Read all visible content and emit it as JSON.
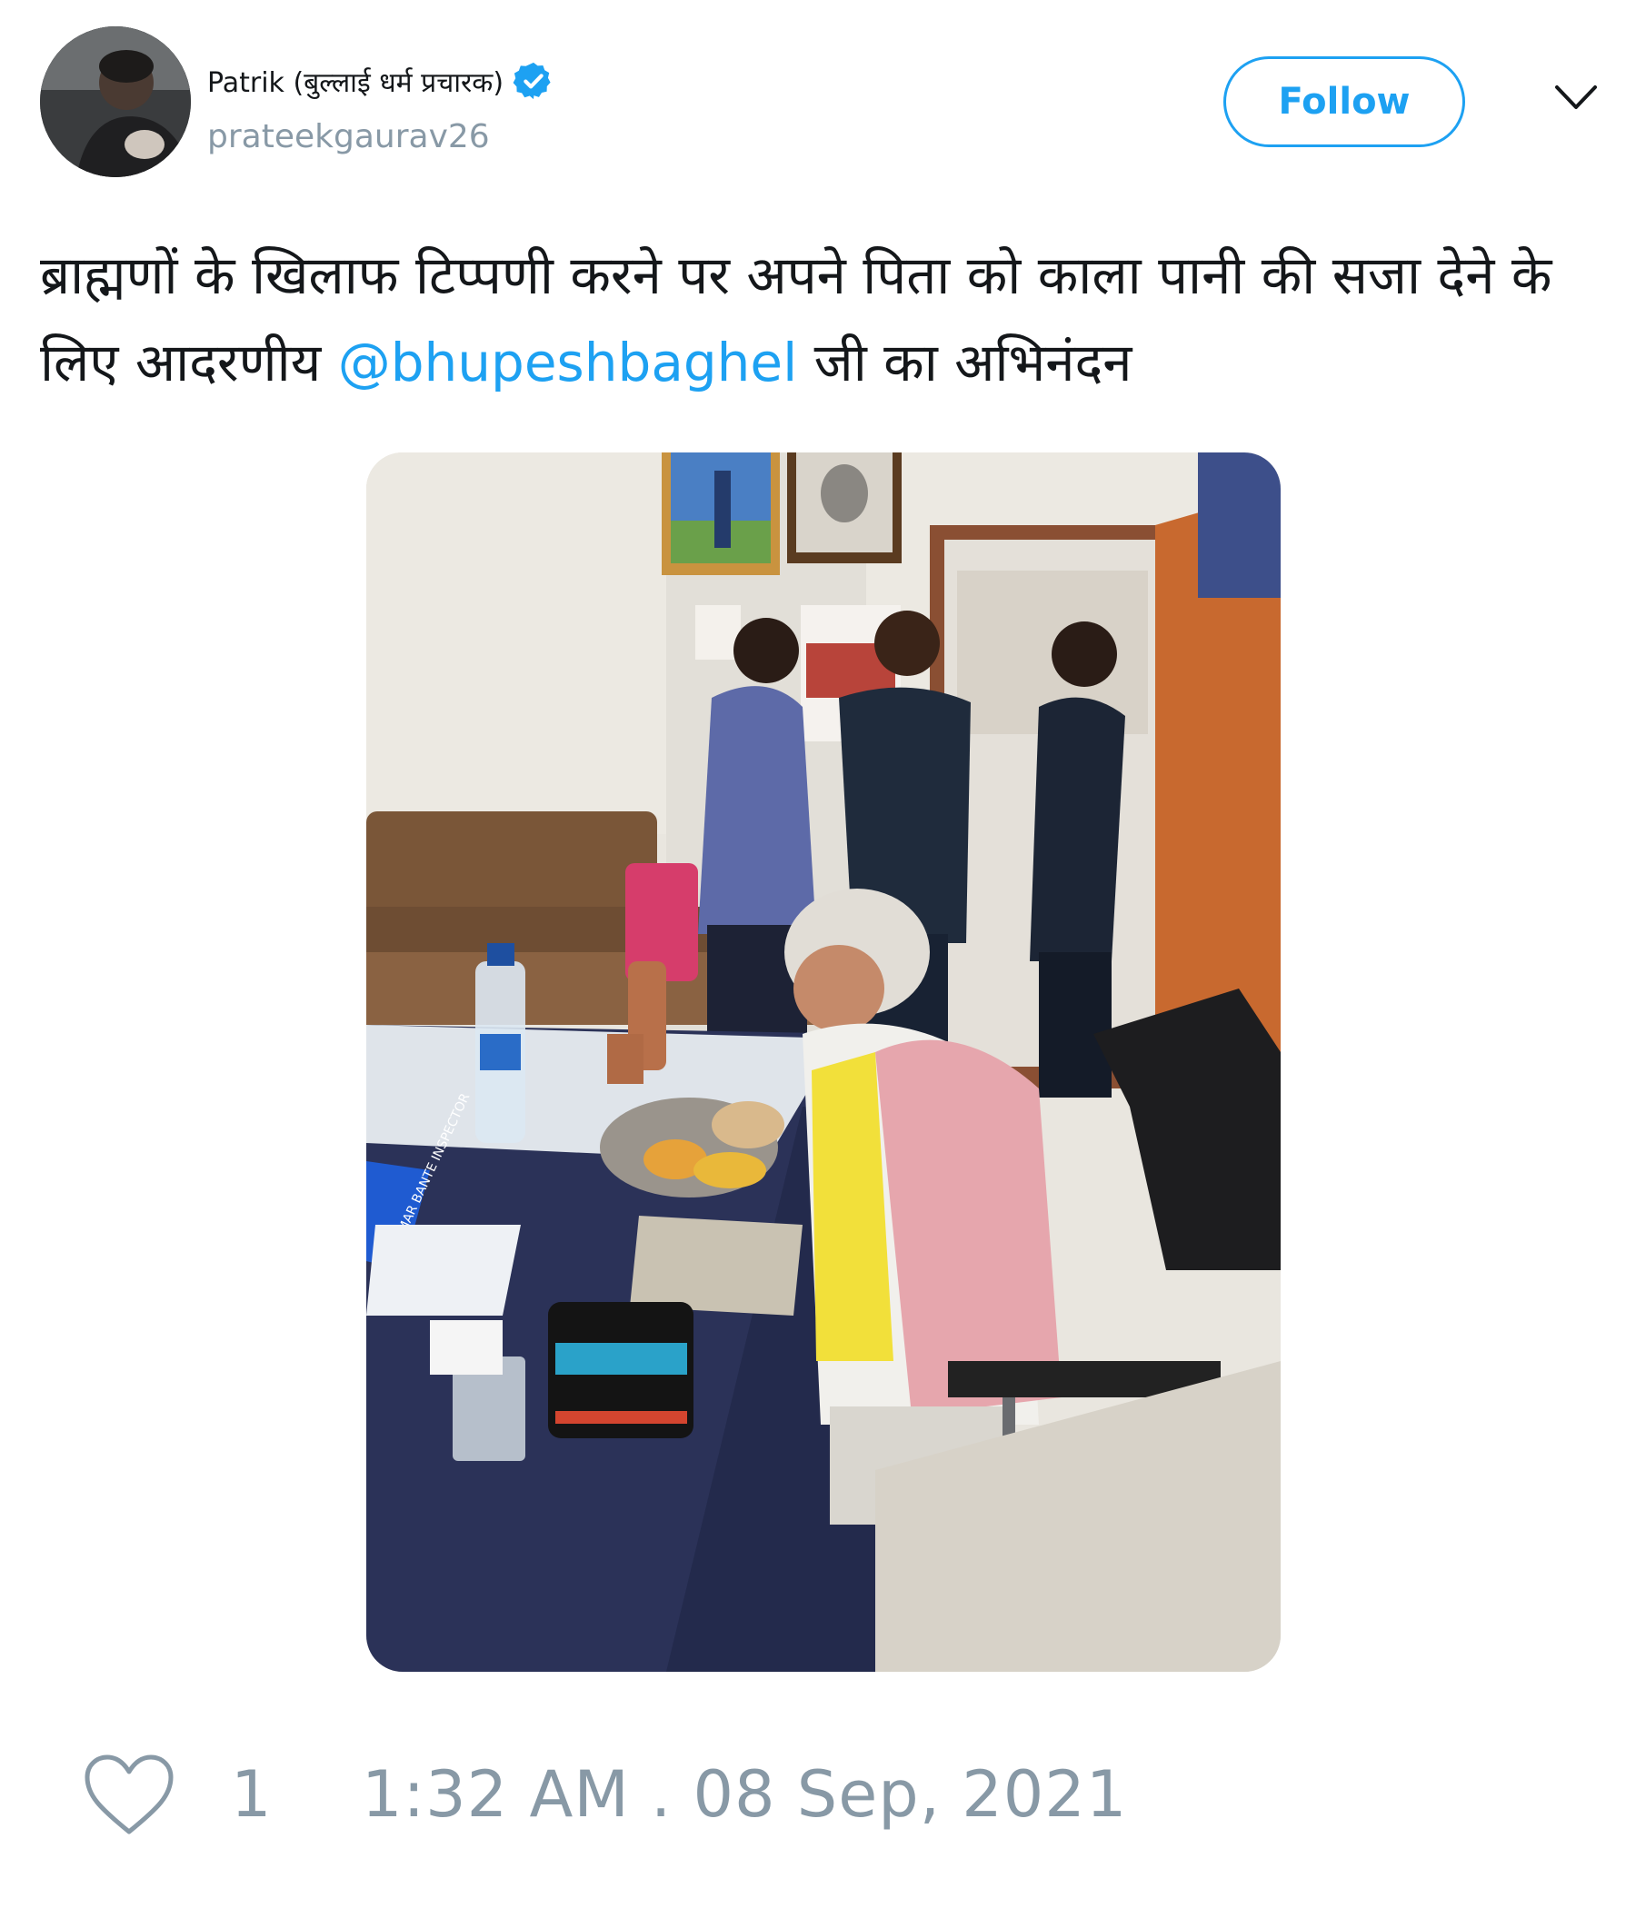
{
  "author": {
    "display_name": "Patrik (बुल्लाई धर्म प्रचारक)",
    "username": "prateekgaurav26",
    "verified": true,
    "avatar_icon": "avatar-photo"
  },
  "follow_label": "Follow",
  "menu_icon": "chevron-down-icon",
  "tweet": {
    "text_before": "ब्राह्मणों के खिलाफ टिप्पणी करने पर अपने पिता को काला पानी की सजा देने के लिए आदरणीय ",
    "mention": "@bhupeshbaghel",
    "text_after": " जी का अभिनंदन"
  },
  "media": {
    "name_plate_text": "KUMAR BANTE INSPECTOR"
  },
  "footer": {
    "like_count": "1",
    "timestamp": "1:32 AM . 08 Sep, 2021"
  },
  "colors": {
    "accent": "#1da1f2",
    "muted": "#8899a6",
    "text": "#14171a"
  }
}
